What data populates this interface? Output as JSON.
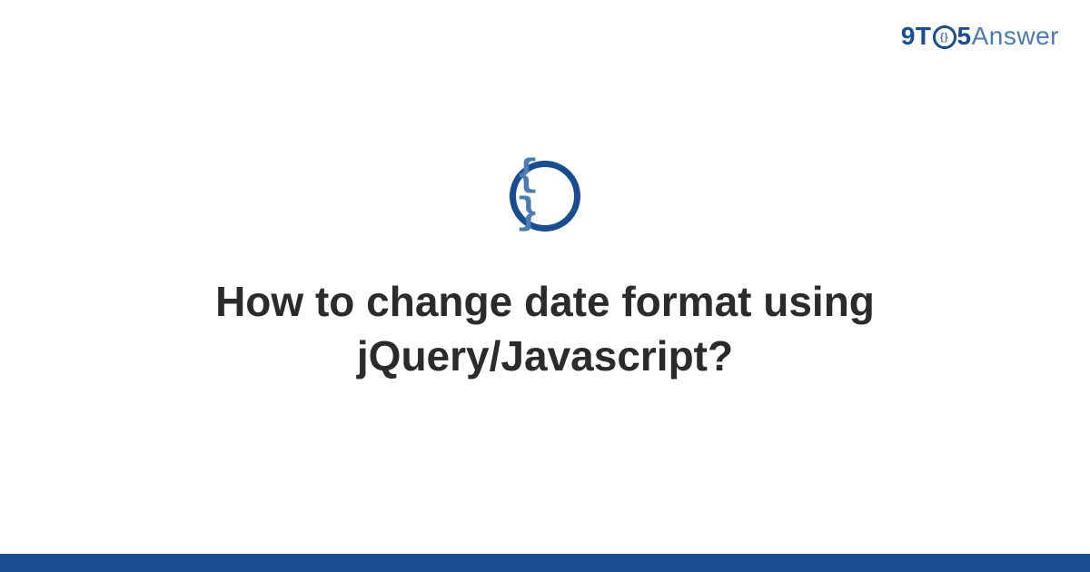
{
  "header": {
    "logo": {
      "part1": "9T",
      "circle_inner": "{}",
      "part2": "5",
      "part3": "Answer"
    }
  },
  "main": {
    "icon_braces": "{ }",
    "title": "How to change date format using jQuery/Javascript?"
  },
  "colors": {
    "brand_dark": "#1a4d8f",
    "brand_light": "#4a7bb5",
    "text": "#2b2b2b"
  }
}
